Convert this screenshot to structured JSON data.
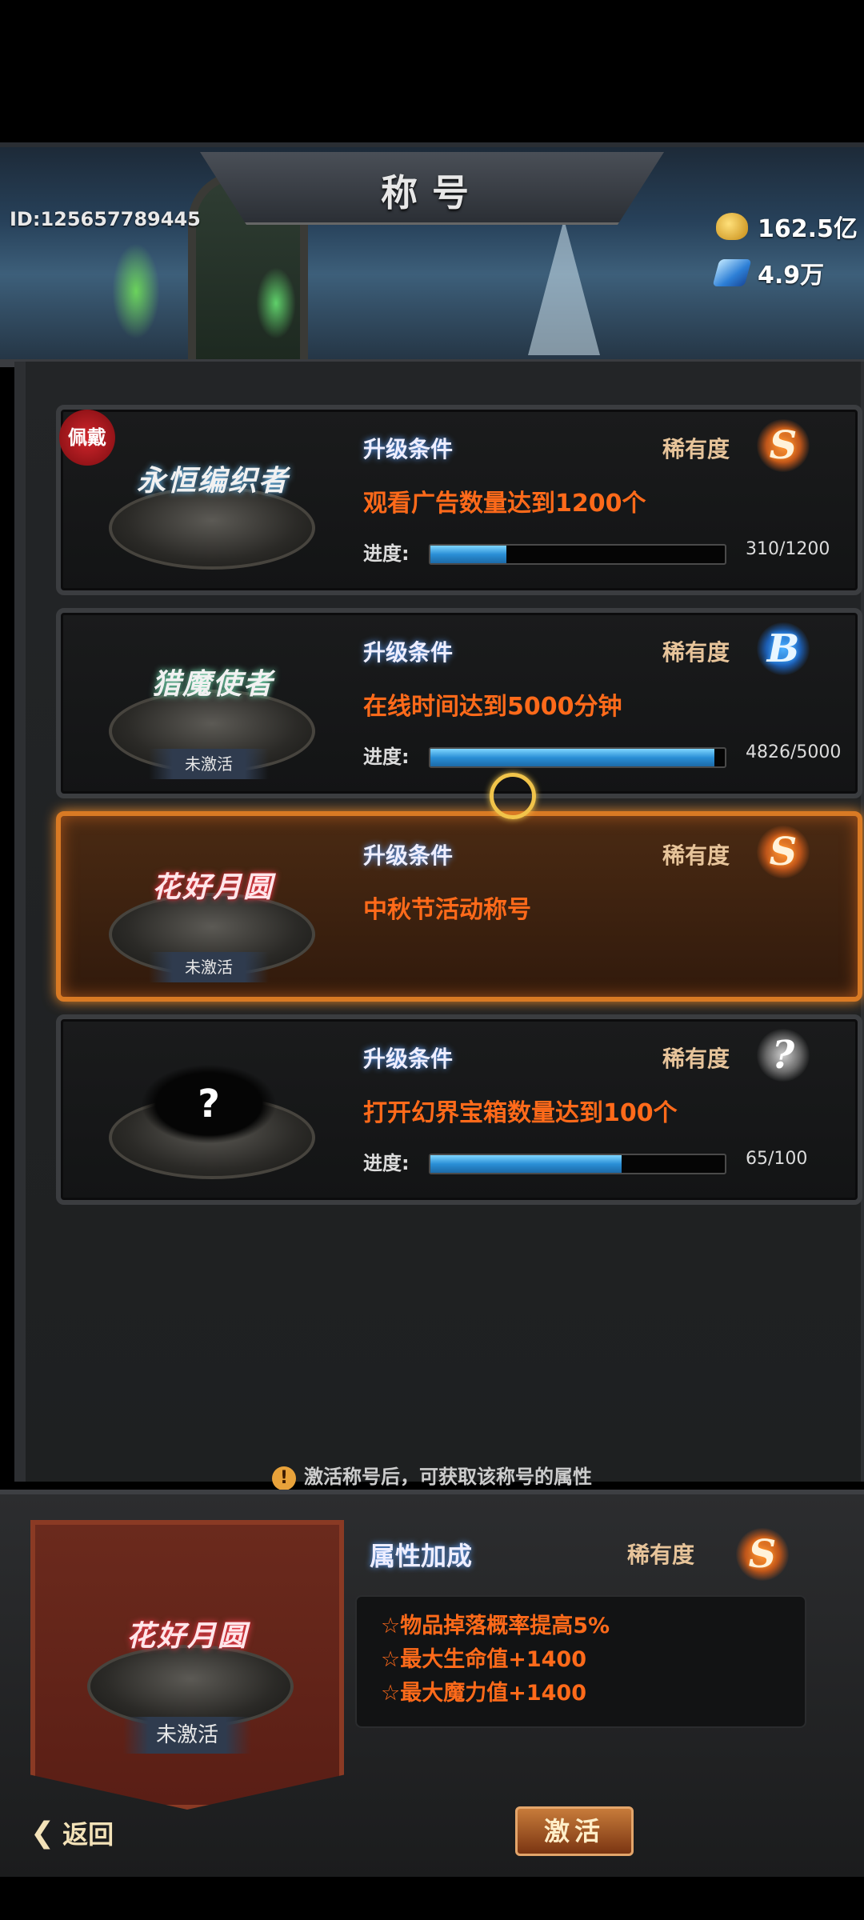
{
  "header": {
    "title": "称号",
    "player_id": "ID:125657789445",
    "gold": "162.5亿",
    "gems": "4.9万"
  },
  "titles": [
    {
      "badge": "佩戴",
      "name": "永恒编织者",
      "condition_label": "升级条件",
      "rarity_label": "稀有度",
      "rarity": "S",
      "condition": "观看广告数量达到1200个",
      "progress_label": "进度:",
      "progress_text": "310/1200",
      "progress": 0.258
    },
    {
      "name": "猎魔使者",
      "status": "未激活",
      "condition_label": "升级条件",
      "rarity_label": "稀有度",
      "rarity": "B",
      "condition": "在线时间达到5000分钟",
      "progress_label": "进度:",
      "progress_text": "4826/5000",
      "progress": 0.965
    },
    {
      "name": "花好月圆",
      "status": "未激活",
      "condition_label": "升级条件",
      "rarity_label": "稀有度",
      "rarity": "S",
      "condition": "中秋节活动称号",
      "selected": true
    },
    {
      "name": "?",
      "condition_label": "升级条件",
      "rarity_label": "稀有度",
      "rarity": "?",
      "condition": "打开幻界宝箱数量达到100个",
      "progress_label": "进度:",
      "progress_text": "65/100",
      "progress": 0.65
    }
  ],
  "hint": "激活称号后，可获取该称号的属性",
  "detail": {
    "name": "花好月圆",
    "status": "未激活",
    "attr_title": "属性加成",
    "rarity_label": "稀有度",
    "rarity": "S",
    "attributes": [
      "☆物品掉落概率提高5%",
      "☆最大生命值+1400",
      "☆最大魔力值+1400"
    ]
  },
  "buttons": {
    "back": "返回",
    "activate": "激活"
  },
  "colors": {
    "condition_text": "#ff6a1a",
    "selected_border": "#d97a24",
    "progress_fill": "#2a8fd6"
  }
}
